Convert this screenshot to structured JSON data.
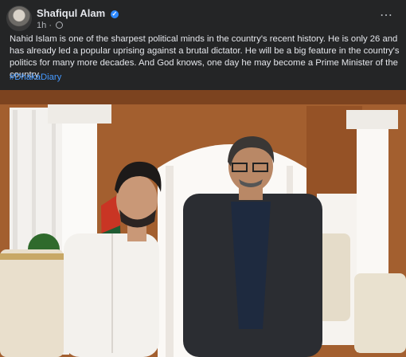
{
  "post": {
    "author": "Shafiqul Alam",
    "time": "1h",
    "separator": "·",
    "more_icon": "⋯",
    "verified_icon": "✓",
    "body": "Nahid Islam is one of the sharpest political minds in the country's recent history. He is only 26 and has already led a popular uprising against a brutal dictator. He will be a big feature in the country's politics for many more decades. And God knows, one day he may become a Prime Minister of the country.",
    "hashtag": "#DhakaDiary"
  },
  "icons": [
    "verified-badge-icon",
    "globe-icon",
    "more-icon"
  ],
  "colors": {
    "background": "#242526",
    "text": "#e4e6eb",
    "secondary": "#b0b3b8",
    "link": "#4599ff",
    "verified": "#2d88ff"
  }
}
